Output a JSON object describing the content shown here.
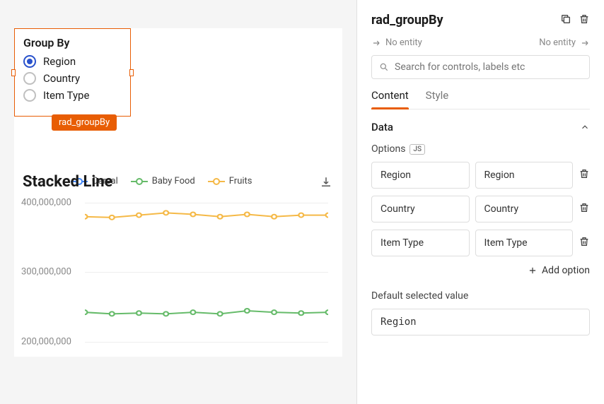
{
  "canvas": {
    "radio_widget": {
      "title": "Group By",
      "options": [
        "Region",
        "Country",
        "Item Type"
      ],
      "selected_index": 0,
      "tag": "rad_groupBy"
    }
  },
  "chart": {
    "title": "Stacked Line",
    "legend": [
      "Cereal",
      "Baby Food",
      "Fruits"
    ],
    "y_ticks": [
      "400,000,000",
      "300,000,000",
      "200,000,000"
    ]
  },
  "chart_data": {
    "type": "line",
    "x_count": 10,
    "ylim": [
      180000000,
      420000000
    ],
    "series": [
      {
        "name": "Fruits",
        "color": "#f5b947",
        "values": [
          363000000,
          362000000,
          365000000,
          368000000,
          366000000,
          363000000,
          366000000,
          363000000,
          365000000,
          365000000
        ]
      },
      {
        "name": "Baby Food",
        "color": "#66bb6a",
        "values": [
          238000000,
          236000000,
          237000000,
          236000000,
          238000000,
          236000000,
          240000000,
          238000000,
          237000000,
          238000000
        ]
      }
    ]
  },
  "panel": {
    "title": "rad_groupBy",
    "entities": {
      "prev": "No entity",
      "next": "No entity"
    },
    "search_placeholder": "Search for controls, labels etc",
    "tabs": {
      "content": "Content",
      "style": "Style"
    },
    "section_data": "Data",
    "options_label": "Options",
    "js_badge": "JS",
    "options": [
      {
        "label": "Region",
        "value": "Region"
      },
      {
        "label": "Country",
        "value": "Country"
      },
      {
        "label": "Item Type",
        "value": "Item Type"
      }
    ],
    "add_option_label": "Add option",
    "default_label": "Default selected value",
    "default_value": "Region"
  }
}
